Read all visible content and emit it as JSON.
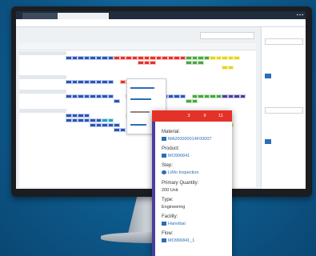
{
  "colors": {
    "blue": "#2a55b8",
    "red": "#e43228",
    "green": "#4aa641",
    "yellow": "#e8d31e",
    "teal": "#2aa0c4",
    "orange": "#f0802a",
    "purple": "#4a3ea2"
  },
  "popup": {
    "bar_values": [
      "3",
      "9",
      "11"
    ],
    "fields": [
      {
        "label": "Material:",
        "value": "MA200000014F00007",
        "icon": "material-icon",
        "link": true
      },
      {
        "label": "Product:",
        "value": "MO996841",
        "icon": "product-icon",
        "link": true
      },
      {
        "label": "Step:",
        "value": "LiMo Inspection",
        "icon": "step-icon",
        "link": true
      },
      {
        "label": "Primary Quantity:",
        "value": "200 Unit",
        "icon": "",
        "link": false
      },
      {
        "label": "Type:",
        "value": "Engineering",
        "icon": "",
        "link": false
      },
      {
        "label": "Facility:",
        "value": "Hannibal",
        "icon": "facility-icon",
        "link": true
      },
      {
        "label": "Flow:",
        "value": "MO996841_1",
        "icon": "flow-icon",
        "link": true
      }
    ]
  }
}
